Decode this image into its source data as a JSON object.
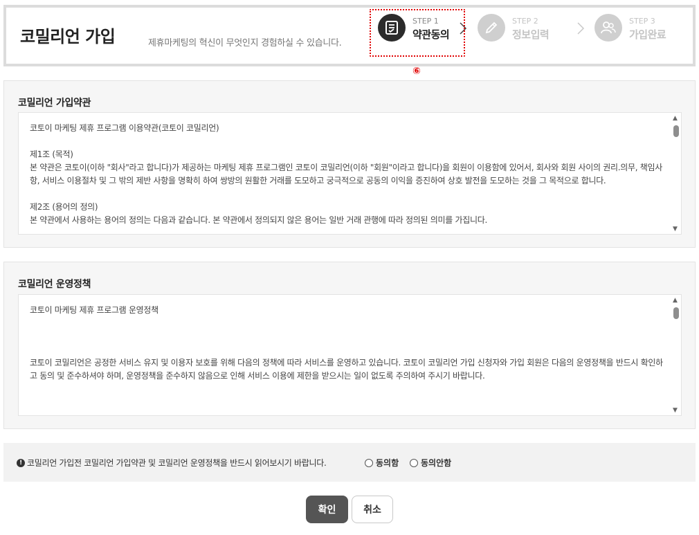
{
  "header": {
    "title": "코밀리언 가입",
    "subtitle": "제휴마케팅의 혁신이 무엇인지 경험하실 수 있습니다.",
    "steps": [
      {
        "num": "STEP 1",
        "name": "약관동의",
        "icon": "document-check-icon",
        "active": true
      },
      {
        "num": "STEP 2",
        "name": "정보입력",
        "icon": "pencil-icon",
        "active": false
      },
      {
        "num": "STEP 3",
        "name": "가입완료",
        "icon": "users-icon",
        "active": false
      }
    ],
    "marker": "⑥"
  },
  "terms": {
    "title": "코밀리언 가입약관",
    "paragraphs": [
      "코토이 마케팅 제휴 프로그램 이용약관(코토이 코밀리언)",
      "",
      "제1조 (목적)",
      "본 약관은 코토이(이하 \"회사\"라고 합니다)가 제공하는 마케팅 제휴 프로그램인 코토이 코밀리언(이하 \"회원\"이라고 합니다)을 회원이 이용함에 있어서, 회사와 회원 사이의 권리.의무, 책임사항, 서비스 이용절차 및 그 밖의 제반 사항을 명확히 하여 쌍방의 원활한 거래를 도모하고 궁극적으로 공동의 이익을 증진하여 상호 발전을 도모하는 것을 그 목적으로 합니다.",
      "",
      "제2조 (용어의 정의)",
      "본 약관에서 사용하는 용어의 정의는 다음과 같습니다. 본 약관에서 정의되지 않은 용어는 일반 거래 관행에 따라 정의된 의미를 가집니다."
    ]
  },
  "policy": {
    "title": "코밀리언 운영정책",
    "paragraphs": [
      "코토이 마케팅 제휴 프로그램 운영정책",
      "",
      "",
      "",
      "코토이 코밀리언은 공정한 서비스 유지 및 이용자 보호를 위해 다음의 정책에 따라 서비스를 운영하고 있습니다. 코토이 코밀리언 가입 신청자와 가입 회원은 다음의 운영정책을 반드시 확인하고 동의 및 준수하셔야 하며, 운영정책을 준수하지 않음으로 인해 서비스 이용에 제한을 받으시는 일이 없도록 주의하여 주시기 바랍니다."
    ]
  },
  "agreement": {
    "notice": "코밀리언 가입전 코밀리언 가입약관 및 코밀리언 운영정책을 반드시 읽어보시기 바랍니다.",
    "agree": "동의함",
    "disagree": "동의안함"
  },
  "buttons": {
    "confirm": "확인",
    "cancel": "취소"
  }
}
